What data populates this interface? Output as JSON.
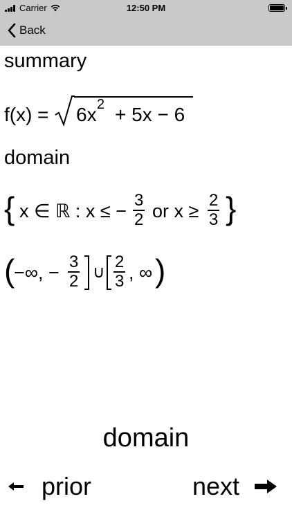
{
  "status_bar": {
    "carrier": "Carrier",
    "time": "12:50 PM"
  },
  "nav_bar": {
    "back_label": "Back"
  },
  "sections": {
    "summary_heading": "summary",
    "function_lhs": "f(x)",
    "function_eq": "=",
    "function_radicand": "6x",
    "function_exp": "2",
    "function_rest": "+ 5x − 6",
    "domain_heading": "domain",
    "set_open": "{",
    "set_var": "x ∈ ℝ : x ≤ −",
    "set_frac1_num": "3",
    "set_frac1_den": "2",
    "set_or": "or x ≥",
    "set_frac2_num": "2",
    "set_frac2_den": "3",
    "set_close": "}",
    "interval_open": "(",
    "interval_part1": "−∞, −",
    "interval_frac1_num": "3",
    "interval_frac1_den": "2",
    "interval_union": "∪",
    "interval_frac2_num": "2",
    "interval_frac2_den": "3",
    "interval_part2": ", ∞",
    "interval_close": ")"
  },
  "footer": {
    "current_topic": "domain",
    "prior_label": "prior",
    "next_label": "next"
  }
}
